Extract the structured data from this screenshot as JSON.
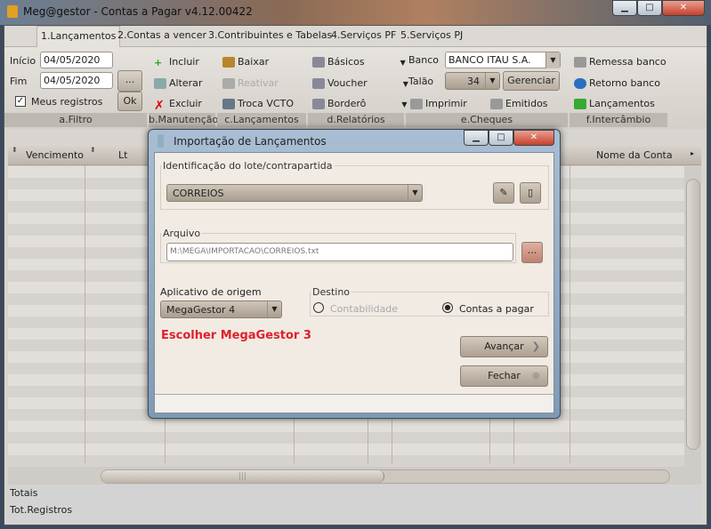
{
  "window": {
    "title": "Meg@gestor - Contas a Pagar v4.12.00422",
    "minimize": "▁",
    "maximize": "□",
    "close": "✕"
  },
  "tabs": [
    "1.Lançamentos",
    "2.Contas a vencer",
    "3.Contribuintes e Tabelas",
    "4.Serviços PF",
    "5.Serviços PJ"
  ],
  "filtro": {
    "inicio_label": "Início",
    "inicio": "04/05/2020",
    "fim_label": "Fim",
    "fim": "04/05/2020",
    "meus_registros": "Meus registros",
    "meus_checked": true,
    "dots": "...",
    "ok": "Ok",
    "group": "a.Filtro"
  },
  "manutencao": {
    "incluir": "Incluir",
    "alterar": "Alterar",
    "excluir": "Excluir",
    "group": "b.Manutenção"
  },
  "lancamentos": {
    "baixar": "Baixar",
    "reativar": "Reativar",
    "troca": "Troca VCTO",
    "group": "c.Lançamentos"
  },
  "relatorios": {
    "basicos": "Básicos",
    "voucher": "Voucher",
    "bordero": "Borderô",
    "group": "d.Relatórios"
  },
  "cheques": {
    "banco_label": "Banco",
    "banco": "BANCO ITAU S.A.",
    "talao_label": "Talão",
    "talao": "34",
    "gerenciar": "Gerenciar",
    "imprimir": "Imprimir",
    "emitidos": "Emitidos",
    "group": "e.Cheques"
  },
  "intercambio": {
    "remessa": "Remessa banco",
    "retorno": "Retorno banco",
    "lancamentos": "Lançamentos",
    "group": "f.Intercâmbio"
  },
  "grid": {
    "columns": [
      "Vencimento",
      "Lt",
      "Nome da Conta"
    ],
    "totais": "Totais",
    "tot_registros": "Tot.Registros"
  },
  "dialog": {
    "title": "Importação de Lançamentos",
    "lote_legend": "Identificação do lote/contrapartida",
    "lote": "CORREIOS",
    "arquivo_legend": "Arquivo",
    "arquivo": "M:\\MEGA\\IMPORTACAO\\CORREIOS.txt",
    "aplicativo_label": "Aplicativo de origem",
    "aplicativo": "MegaGestor 4",
    "destino_legend": "Destino",
    "contabilidade": "Contabilidade",
    "contas_pagar": "Contas a pagar",
    "destino_selected": "Contas a pagar",
    "annotation": "Escolher MegaGestor 3",
    "annotation_color": "#e0202a",
    "avancar": "Avançar",
    "fechar": "Fechar",
    "dots": "..."
  }
}
